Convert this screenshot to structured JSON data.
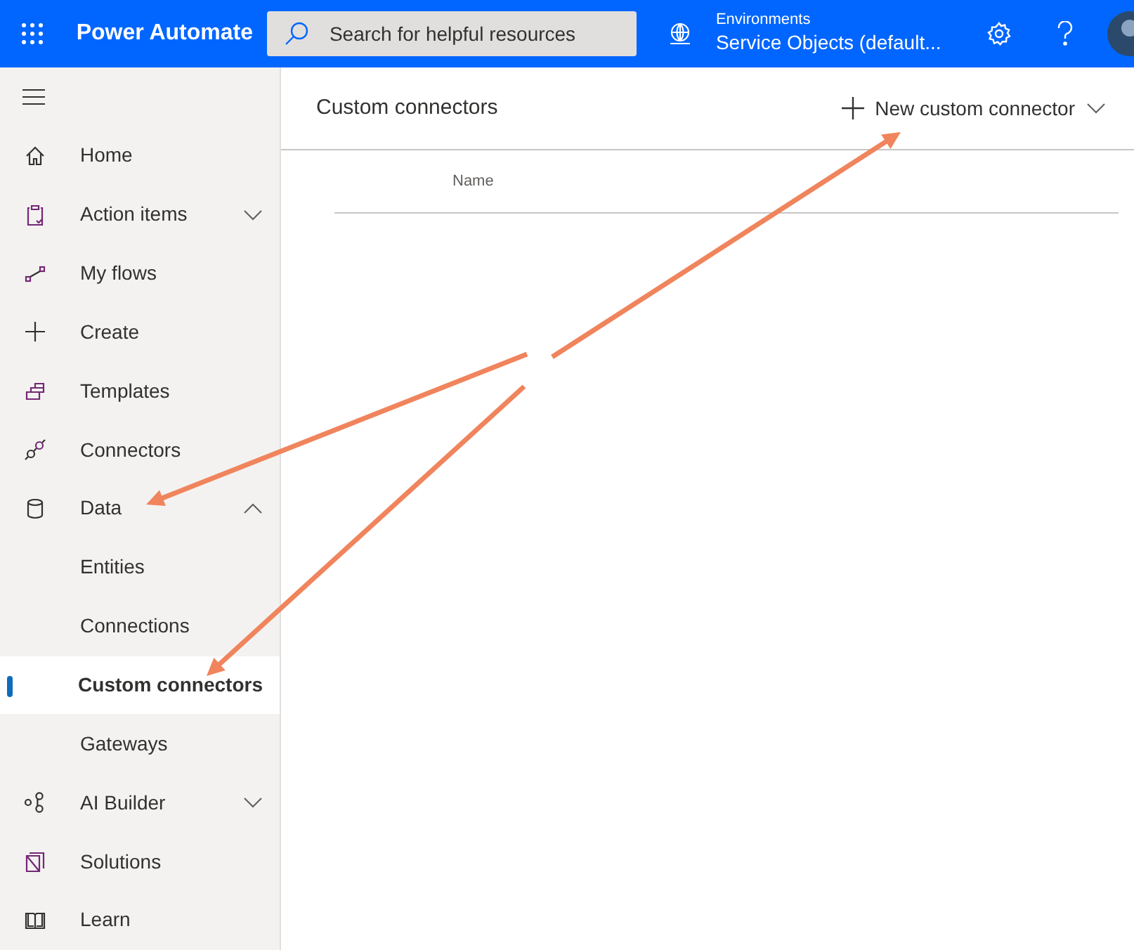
{
  "header": {
    "app_name": "Power Automate",
    "search": {
      "placeholder": "Search for helpful resources"
    },
    "environment": {
      "label": "Environments",
      "value": "Service Objects (default..."
    }
  },
  "sidebar": {
    "items": [
      {
        "label": "Home",
        "selected": false
      },
      {
        "label": "Action items",
        "selected": false,
        "expanded": false
      },
      {
        "label": "My flows",
        "selected": false
      },
      {
        "label": "Create",
        "selected": false
      },
      {
        "label": "Templates",
        "selected": false
      },
      {
        "label": "Connectors",
        "selected": false
      },
      {
        "label": "Data",
        "selected": false,
        "expanded": true,
        "children": [
          {
            "label": "Entities",
            "selected": false
          },
          {
            "label": "Connections",
            "selected": false
          },
          {
            "label": "Custom connectors",
            "selected": true
          },
          {
            "label": "Gateways",
            "selected": false
          }
        ]
      },
      {
        "label": "AI Builder",
        "selected": false,
        "expanded": false
      },
      {
        "label": "Solutions",
        "selected": false
      },
      {
        "label": "Learn",
        "selected": false
      }
    ]
  },
  "page": {
    "title": "Custom connectors",
    "new_button": "New custom connector",
    "table": {
      "columns": [
        "Name"
      ]
    }
  }
}
